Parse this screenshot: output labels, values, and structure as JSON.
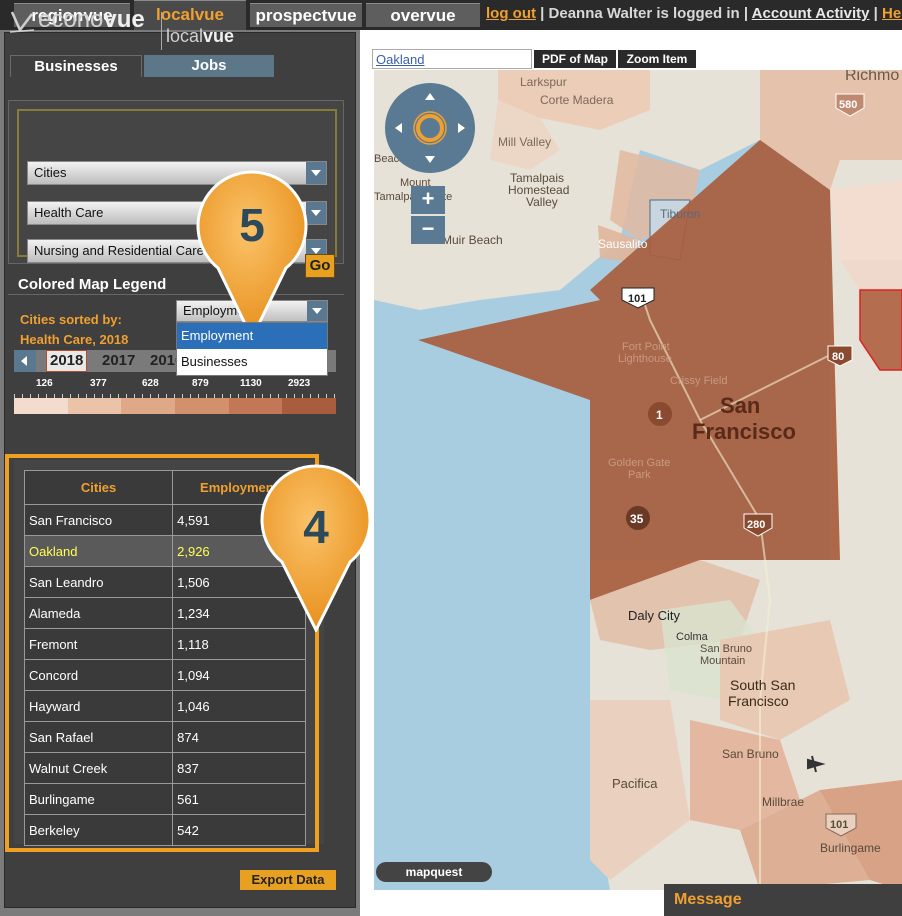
{
  "topnav": {
    "tabs": [
      {
        "label": "regionvue"
      },
      {
        "label": "localvue"
      },
      {
        "label": "prospectvue"
      },
      {
        "label": "overvue"
      }
    ],
    "logout": "log out",
    "sep1": " | ",
    "logged_in": "Deanna Walter is logged in",
    "sep2": " | ",
    "account_activity": "Account Activity",
    "sep3": " | ",
    "help": "Help"
  },
  "brand": {
    "econo": "econo",
    "vue": "vue",
    "local": "local",
    "localvue": "vue"
  },
  "subtabs": {
    "businesses": "Businesses",
    "jobs": "Jobs"
  },
  "filters": {
    "geography": "Cities",
    "industry": "Health Care",
    "subindustry": "Nursing and Residential Care"
  },
  "go_label": "Go",
  "legend": {
    "title": "Colored Map Legend",
    "sorted_by": "Cities sorted by:",
    "sorted_sub": "Health Care, 2018",
    "metric_selected": "Employment",
    "metric_options": [
      "Employment",
      "Businesses"
    ],
    "years": [
      "2018",
      "2017",
      "2016"
    ],
    "active_year": "2018",
    "scale_labels": [
      "126",
      "377",
      "628",
      "879",
      "1130",
      "2923"
    ],
    "scale_colors": [
      "#f3dccd",
      "#eac3a9",
      "#dfa887",
      "#d2906d",
      "#c27756",
      "#a85d3e"
    ]
  },
  "table": {
    "headers": [
      "Cities",
      "Employment"
    ],
    "rows": [
      {
        "city": "San Francisco",
        "value": "4,591"
      },
      {
        "city": "Oakland",
        "value": "2,926"
      },
      {
        "city": "San Leandro",
        "value": "1,506"
      },
      {
        "city": "Alameda",
        "value": "1,234"
      },
      {
        "city": "Fremont",
        "value": "1,118"
      },
      {
        "city": "Concord",
        "value": "1,094"
      },
      {
        "city": "Hayward",
        "value": "1,046"
      },
      {
        "city": "San Rafael",
        "value": "874"
      },
      {
        "city": "Walnut Creek",
        "value": "837"
      },
      {
        "city": "Burlingame",
        "value": "561"
      },
      {
        "city": "Berkeley",
        "value": "542"
      }
    ],
    "highlighted_city": "Oakland"
  },
  "export_label": "Export Data",
  "map": {
    "search_value": "Oakland",
    "pdf_label": "PDF of Map",
    "zoom_item_label": "Zoom Item",
    "zoom_in": "+",
    "zoom_out": "−",
    "places": {
      "sf_line1": "San",
      "sf_line2": "Francisco",
      "richmond": "Richmo",
      "larkspur": "Larkspur",
      "corte_madera": "Corte Madera",
      "mill_valley": "Mill Valley",
      "tamalpais_homestead": "Tamalpais",
      "homestead": "Homestead",
      "valley": "Valley",
      "mount": "Mount",
      "tamalpais_state": "Tamalpais State",
      "beach": "Beac",
      "muir_beach": "Muir Beach",
      "tiburon": "Tiburon",
      "sausalito": "Sausalito",
      "fort_point": "Fort Point",
      "lighthouse": "Lighthouse",
      "crissy_field": "Crissy Field",
      "golden_gate": "Golden Gate",
      "park": "Park",
      "daly_city": "Daly City",
      "colma": "Colma",
      "san_bruno_mtn": "San Bruno",
      "mountain": "Mountain",
      "south_sf_1": "South San",
      "south_sf_2": "Francisco",
      "san_bruno": "San Bruno",
      "pacifica": "Pacifica",
      "millbrae": "Millbrae",
      "burlingame": "Burlingame"
    },
    "shields": [
      "101",
      "80",
      "1",
      "35",
      "280",
      "580",
      "101"
    ],
    "mapquest": "mapquest",
    "message": "Message"
  },
  "callouts": [
    "5",
    "4"
  ],
  "colors": {
    "accent": "#f0a030",
    "sf_fill": "#a85d3e",
    "water": "#a8cde0",
    "land": "#e8e4dc"
  }
}
